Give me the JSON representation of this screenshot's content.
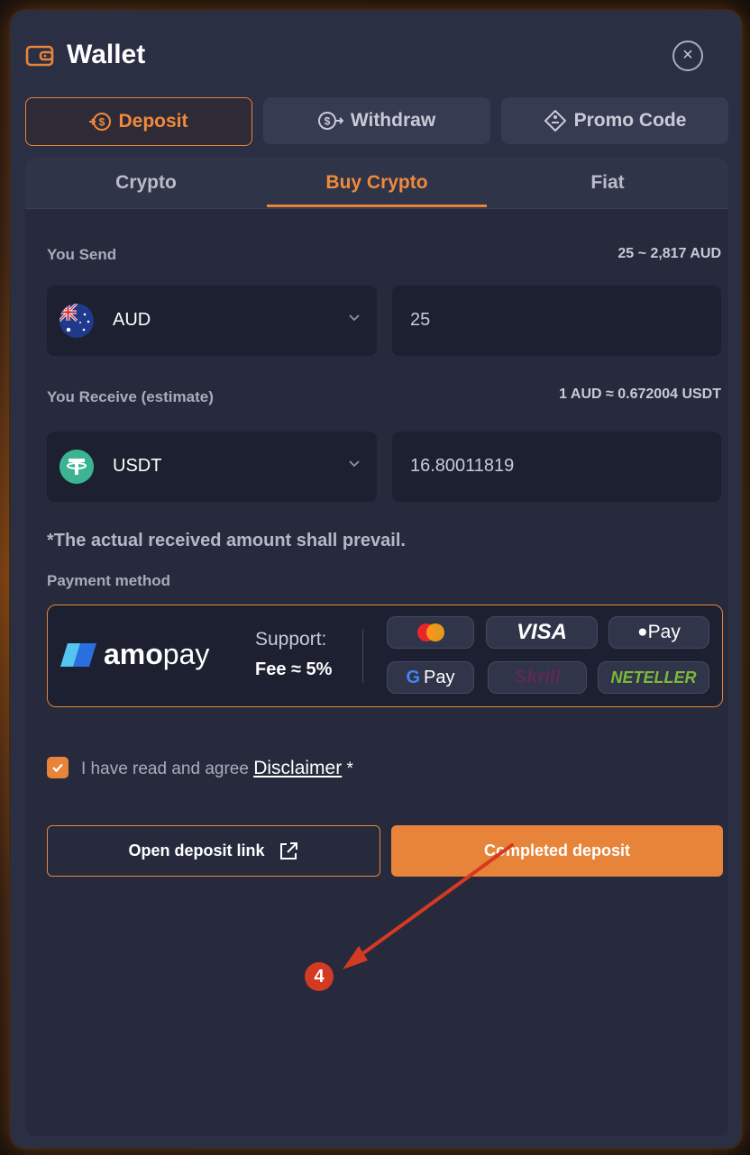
{
  "header": {
    "title": "Wallet"
  },
  "top_tabs": [
    {
      "label": "Deposit",
      "active": true
    },
    {
      "label": "Withdraw",
      "active": false
    },
    {
      "label": "Promo Code",
      "active": false
    }
  ],
  "sub_tabs": [
    {
      "label": "Crypto",
      "active": false
    },
    {
      "label": "Buy Crypto",
      "active": true
    },
    {
      "label": "Fiat",
      "active": false
    }
  ],
  "send": {
    "label": "You Send",
    "range": "25 ~ 2,817 AUD",
    "currency": "AUD",
    "amount": "25"
  },
  "receive": {
    "label": "You Receive (estimate)",
    "rate": "1 AUD ≈ 0.672004 USDT",
    "currency": "USDT",
    "amount": "16.80011819"
  },
  "note": "*The actual received amount shall prevail.",
  "payment": {
    "label": "Payment method",
    "provider_bold": "amo",
    "provider_rest": "pay",
    "support_label": "Support:",
    "fee": "Fee ≈ 5%",
    "methods": [
      "Mastercard",
      "VISA",
      "Pay",
      "Pay",
      "Skrill",
      "NETELLER"
    ]
  },
  "agreement": {
    "text": "I have read and agree",
    "link": "Disclaimer",
    "required_mark": "*",
    "checked": true
  },
  "actions": {
    "open_link_label": "Open deposit link",
    "completed_label": "Completed deposit"
  },
  "annotation": {
    "step": "4"
  },
  "colors": {
    "accent": "#e8843a",
    "panel": "#262a3c",
    "field": "#1d2030",
    "annotation": "#d43a22"
  }
}
